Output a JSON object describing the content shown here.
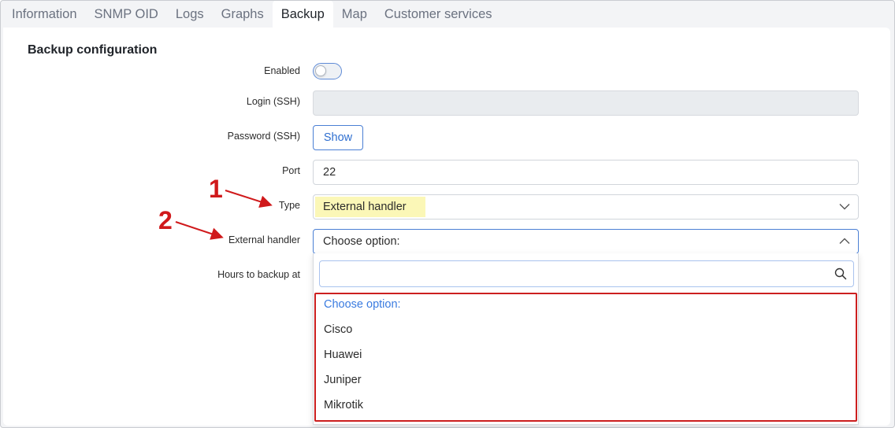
{
  "tabs": [
    {
      "label": "Information"
    },
    {
      "label": "SNMP OID"
    },
    {
      "label": "Logs"
    },
    {
      "label": "Graphs"
    },
    {
      "label": "Backup",
      "active": true
    },
    {
      "label": "Map"
    },
    {
      "label": "Customer services"
    }
  ],
  "section": {
    "title": "Backup configuration"
  },
  "form": {
    "enabled": {
      "label": "Enabled",
      "value": false
    },
    "login": {
      "label": "Login (SSH)",
      "value": ""
    },
    "password": {
      "label": "Password (SSH)",
      "button": "Show"
    },
    "port": {
      "label": "Port",
      "value": "22"
    },
    "type": {
      "label": "Type",
      "value": "External handler"
    },
    "external_handler": {
      "label": "External handler",
      "value": "Choose option:",
      "search_value": ""
    },
    "hours": {
      "label": "Hours to backup at"
    }
  },
  "dropdown_options": [
    "Choose option:",
    "Cisco",
    "Huawei",
    "Juniper",
    "Mikrotik"
  ],
  "annotations": {
    "marker_1": "1",
    "marker_2": "2"
  },
  "colors": {
    "accent": "#4a7fd4",
    "annotation": "#d0191b",
    "highlight": "#fbf7b7"
  }
}
